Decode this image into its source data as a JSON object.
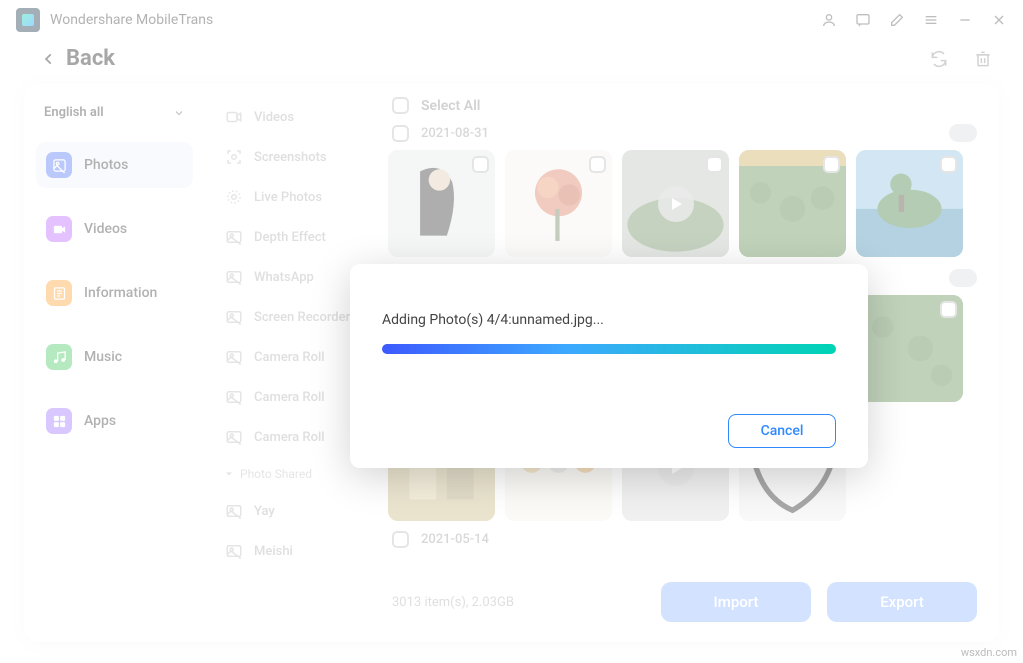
{
  "app": {
    "title": "Wondershare MobileTrans"
  },
  "back": {
    "label": "Back"
  },
  "sidebar": {
    "lang": "English all",
    "items": [
      {
        "label": "Photos"
      },
      {
        "label": "Videos"
      },
      {
        "label": "Information"
      },
      {
        "label": "Music"
      },
      {
        "label": "Apps"
      }
    ]
  },
  "categories": {
    "items": [
      {
        "label": "Videos"
      },
      {
        "label": "Screenshots"
      },
      {
        "label": "Live Photos"
      },
      {
        "label": "Depth Effect"
      },
      {
        "label": "WhatsApp"
      },
      {
        "label": "Screen Recorder"
      },
      {
        "label": "Camera Roll"
      },
      {
        "label": "Camera Roll"
      },
      {
        "label": "Camera Roll"
      }
    ],
    "shared_header": "Photo Shared",
    "shared": [
      {
        "label": "Yay"
      },
      {
        "label": "Meishi"
      }
    ]
  },
  "content": {
    "select_all": "Select All",
    "dates": [
      "2021-08-31",
      "2021-05-14"
    ],
    "stats": "3013 item(s), 2.03GB"
  },
  "buttons": {
    "import": "Import",
    "export": "Export"
  },
  "modal": {
    "text": "Adding Photo(s) 4/4:unnamed.jpg...",
    "cancel": "Cancel"
  },
  "watermark": "wsxdn.com"
}
